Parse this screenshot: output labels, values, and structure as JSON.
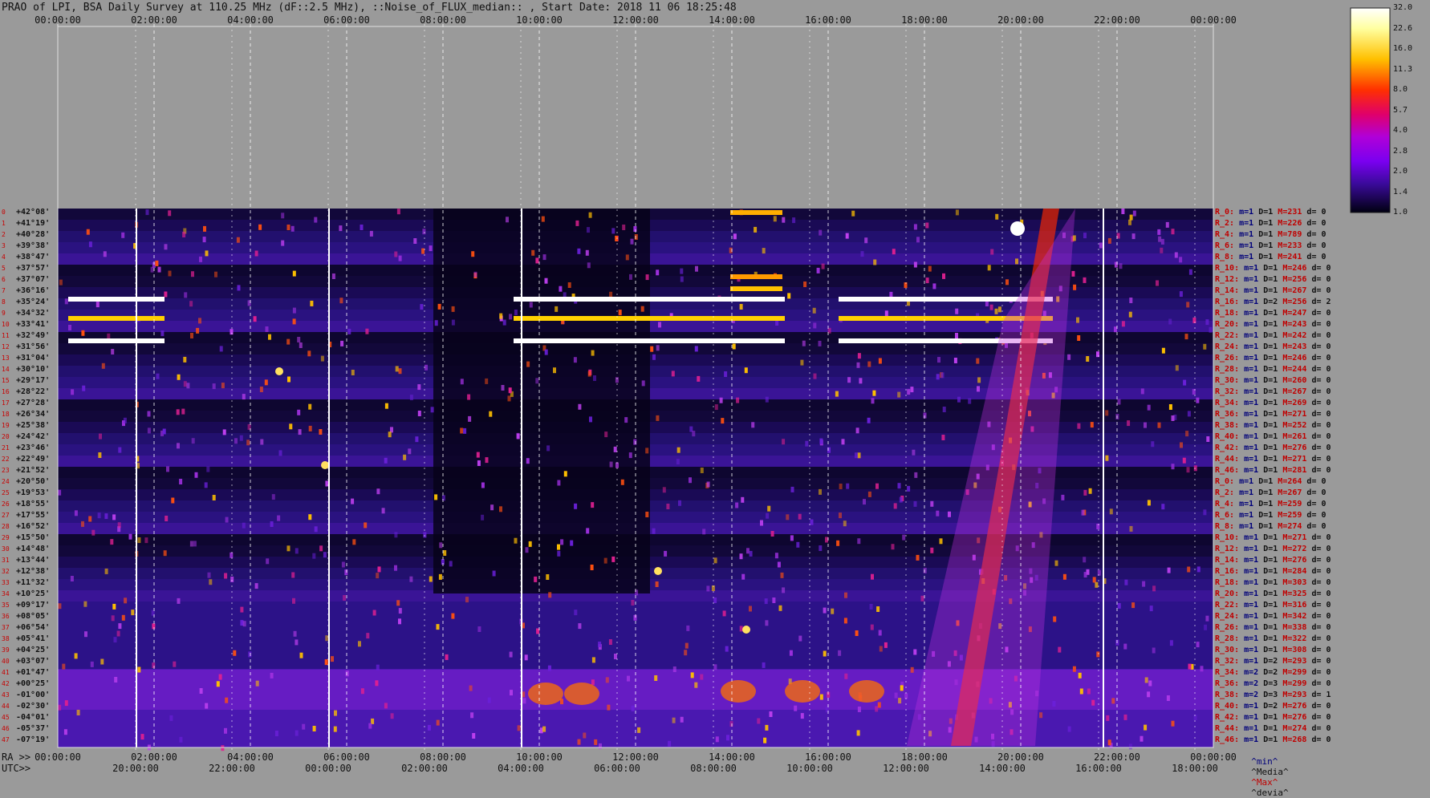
{
  "title": "PRAO of LPI, BSA Daily Survey at 110.25 MHz (dF::2.5 MHz), ::Noise_of_FLUX_median:: , Start Date: 2018 11 06 18:25:48",
  "colors": {
    "background": "#9a9a9a",
    "accent_red": "#c00000",
    "accent_blue": "#00007a"
  },
  "chart_data": {
    "type": "heatmap",
    "title": "PRAO of LPI, BSA Daily Survey at 110.25 MHz (dF::2.5 MHz), ::Noise_of_FLUX_median:: , Start Date: 2018 11 06 18:25:48",
    "x_ticks_ra_top": [
      "00:00:00",
      "02:00:00",
      "04:00:00",
      "06:00:00",
      "08:00:00",
      "10:00:00",
      "12:00:00",
      "14:00:00",
      "16:00:00",
      "18:00:00",
      "20:00:00",
      "22:00:00",
      "00:00:00"
    ],
    "x_ticks_ra_bottom": [
      "00:00:00",
      "02:00:00",
      "04:00:00",
      "06:00:00",
      "08:00:00",
      "10:00:00",
      "12:00:00",
      "14:00:00",
      "16:00:00",
      "18:00:00",
      "20:00:00",
      "22:00:00",
      "00:00:00"
    ],
    "x_ticks_utc": [
      "20:00:00",
      "22:00:00",
      "00:00:00",
      "02:00:00",
      "04:00:00",
      "06:00:00",
      "08:00:00",
      "10:00:00",
      "12:00:00",
      "14:00:00",
      "16:00:00",
      "18:00:00"
    ],
    "ra_label": "RA >>",
    "utc_label": "UTC>>",
    "declinations": [
      "+42°08'",
      "+41°19'",
      "+40°28'",
      "+39°38'",
      "+38°47'",
      "+37°57'",
      "+37°07'",
      "+36°16'",
      "+35°24'",
      "+34°32'",
      "+33°41'",
      "+32°49'",
      "+31°56'",
      "+31°04'",
      "+30°10'",
      "+29°17'",
      "+28°22'",
      "+27°28'",
      "+26°34'",
      "+25°38'",
      "+24°42'",
      "+23°46'",
      "+22°49'",
      "+21°52'",
      "+20°50'",
      "+19°53'",
      "+18°55'",
      "+17°55'",
      "+16°52'",
      "+15°50'",
      "+14°48'",
      "+13°44'",
      "+12°38'",
      "+11°32'",
      "+10°25'",
      "+09°17'",
      "+08°05'",
      "+06°54'",
      "+05°41'",
      "+04°25'",
      "+03°07'",
      "+01°47'",
      "+00°25'",
      "-01°00'",
      "-02°30'",
      "-04°01'",
      "-05°37'",
      "-07°19'"
    ],
    "colorbar_ticks": [
      "32.0",
      "22.6",
      "16.0",
      "11.3",
      "8.0",
      "5.7",
      "4.0",
      "2.8",
      "2.0",
      "1.4",
      "1.0"
    ],
    "row_stats": [
      {
        "r": "R_0:",
        "m": "1",
        "D": "1",
        "M": "231",
        "d": "0"
      },
      {
        "r": "R_2:",
        "m": "1",
        "D": "1",
        "M": "226",
        "d": "0"
      },
      {
        "r": "R_4:",
        "m": "1",
        "D": "1",
        "M": "789",
        "d": "0"
      },
      {
        "r": "R_6:",
        "m": "1",
        "D": "1",
        "M": "233",
        "d": "0"
      },
      {
        "r": "R_8:",
        "m": "1",
        "D": "1",
        "M": "241",
        "d": "0"
      },
      {
        "r": "R_10:",
        "m": "1",
        "D": "1",
        "M": "246",
        "d": "0"
      },
      {
        "r": "R_12:",
        "m": "1",
        "D": "1",
        "M": "256",
        "d": "0"
      },
      {
        "r": "R_14:",
        "m": "1",
        "D": "1",
        "M": "267",
        "d": "0"
      },
      {
        "r": "R_16:",
        "m": "1",
        "D": "2",
        "M": "256",
        "d": "2"
      },
      {
        "r": "R_18:",
        "m": "1",
        "D": "1",
        "M": "247",
        "d": "0"
      },
      {
        "r": "R_20:",
        "m": "1",
        "D": "1",
        "M": "243",
        "d": "0"
      },
      {
        "r": "R_22:",
        "m": "1",
        "D": "1",
        "M": "242",
        "d": "0"
      },
      {
        "r": "R_24:",
        "m": "1",
        "D": "1",
        "M": "243",
        "d": "0"
      },
      {
        "r": "R_26:",
        "m": "1",
        "D": "1",
        "M": "246",
        "d": "0"
      },
      {
        "r": "R_28:",
        "m": "1",
        "D": "1",
        "M": "244",
        "d": "0"
      },
      {
        "r": "R_30:",
        "m": "1",
        "D": "1",
        "M": "260",
        "d": "0"
      },
      {
        "r": "R_32:",
        "m": "1",
        "D": "1",
        "M": "267",
        "d": "0"
      },
      {
        "r": "R_34:",
        "m": "1",
        "D": "1",
        "M": "269",
        "d": "0"
      },
      {
        "r": "R_36:",
        "m": "1",
        "D": "1",
        "M": "271",
        "d": "0"
      },
      {
        "r": "R_38:",
        "m": "1",
        "D": "1",
        "M": "252",
        "d": "0"
      },
      {
        "r": "R_40:",
        "m": "1",
        "D": "1",
        "M": "261",
        "d": "0"
      },
      {
        "r": "R_42:",
        "m": "1",
        "D": "1",
        "M": "276",
        "d": "0"
      },
      {
        "r": "R_44:",
        "m": "1",
        "D": "1",
        "M": "271",
        "d": "0"
      },
      {
        "r": "R_46:",
        "m": "1",
        "D": "1",
        "M": "281",
        "d": "0"
      },
      {
        "r": "R_0:",
        "m": "1",
        "D": "1",
        "M": "264",
        "d": "0"
      },
      {
        "r": "R_2:",
        "m": "1",
        "D": "1",
        "M": "267",
        "d": "0"
      },
      {
        "r": "R_4:",
        "m": "1",
        "D": "1",
        "M": "259",
        "d": "0"
      },
      {
        "r": "R_6:",
        "m": "1",
        "D": "1",
        "M": "259",
        "d": "0"
      },
      {
        "r": "R_8:",
        "m": "1",
        "D": "1",
        "M": "274",
        "d": "0"
      },
      {
        "r": "R_10:",
        "m": "1",
        "D": "1",
        "M": "271",
        "d": "0"
      },
      {
        "r": "R_12:",
        "m": "1",
        "D": "1",
        "M": "272",
        "d": "0"
      },
      {
        "r": "R_14:",
        "m": "1",
        "D": "1",
        "M": "276",
        "d": "0"
      },
      {
        "r": "R_16:",
        "m": "1",
        "D": "1",
        "M": "284",
        "d": "0"
      },
      {
        "r": "R_18:",
        "m": "1",
        "D": "1",
        "M": "303",
        "d": "0"
      },
      {
        "r": "R_20:",
        "m": "1",
        "D": "1",
        "M": "325",
        "d": "0"
      },
      {
        "r": "R_22:",
        "m": "1",
        "D": "1",
        "M": "316",
        "d": "0"
      },
      {
        "r": "R_24:",
        "m": "1",
        "D": "1",
        "M": "342",
        "d": "0"
      },
      {
        "r": "R_26:",
        "m": "1",
        "D": "1",
        "M": "338",
        "d": "0"
      },
      {
        "r": "R_28:",
        "m": "1",
        "D": "1",
        "M": "322",
        "d": "0"
      },
      {
        "r": "R_30:",
        "m": "1",
        "D": "1",
        "M": "308",
        "d": "0"
      },
      {
        "r": "R_32:",
        "m": "1",
        "D": "2",
        "M": "293",
        "d": "0"
      },
      {
        "r": "R_34:",
        "m": "2",
        "D": "2",
        "M": "299",
        "d": "0"
      },
      {
        "r": "R_36:",
        "m": "2",
        "D": "3",
        "M": "299",
        "d": "0"
      },
      {
        "r": "R_38:",
        "m": "2",
        "D": "3",
        "M": "293",
        "d": "1"
      },
      {
        "r": "R_40:",
        "m": "1",
        "D": "2",
        "M": "276",
        "d": "0"
      },
      {
        "r": "R_42:",
        "m": "1",
        "D": "1",
        "M": "276",
        "d": "0"
      },
      {
        "r": "R_44:",
        "m": "1",
        "D": "1",
        "M": "274",
        "d": "0"
      },
      {
        "r": "R_46:",
        "m": "1",
        "D": "1",
        "M": "268",
        "d": "0"
      }
    ],
    "bottom_legend": [
      "^min^",
      "^Media^",
      "^Max^",
      "^devia^"
    ]
  }
}
